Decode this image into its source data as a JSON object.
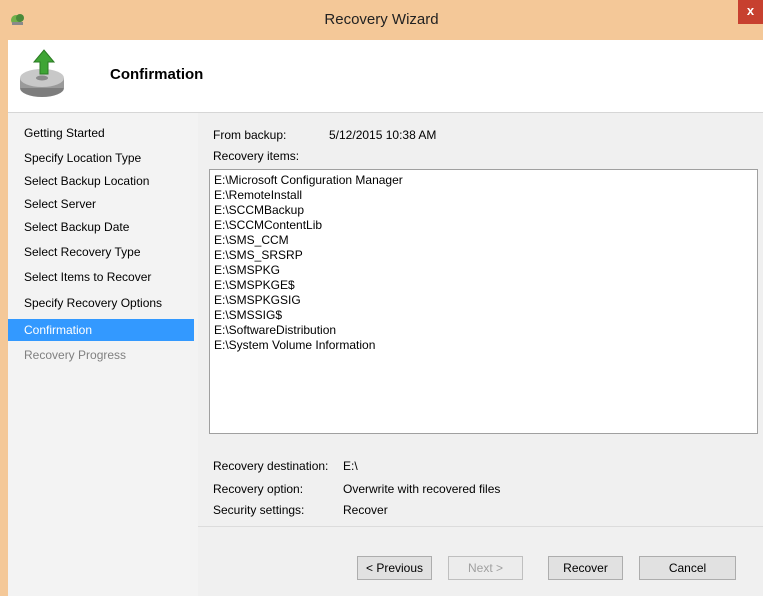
{
  "window": {
    "title": "Recovery Wizard",
    "close_glyph": "x",
    "icon": "backup-app-icon"
  },
  "header": {
    "title": "Confirmation",
    "icon": "restore-disk-icon"
  },
  "nav": {
    "items": [
      {
        "label": "Getting Started",
        "state": "normal"
      },
      {
        "label": "Specify Location Type",
        "state": "normal"
      },
      {
        "label": "Select Backup Location",
        "state": "normal"
      },
      {
        "label": "Select Server",
        "state": "normal"
      },
      {
        "label": "Select Backup Date",
        "state": "normal"
      },
      {
        "label": "Select Recovery Type",
        "state": "normal"
      },
      {
        "label": "Select Items to Recover",
        "state": "normal"
      },
      {
        "label": "Specify Recovery Options",
        "state": "normal"
      },
      {
        "label": "Confirmation",
        "state": "active"
      },
      {
        "label": "Recovery Progress",
        "state": "disabled"
      }
    ]
  },
  "main": {
    "from_backup_label": "From backup:",
    "from_backup_value": "5/12/2015 10:38 AM",
    "recovery_items_label": "Recovery items:",
    "recovery_items": [
      "E:\\Microsoft Configuration Manager",
      "E:\\RemoteInstall",
      "E:\\SCCMBackup",
      "E:\\SCCMContentLib",
      "E:\\SMS_CCM",
      "E:\\SMS_SRSRP",
      "E:\\SMSPKG",
      "E:\\SMSPKGE$",
      "E:\\SMSPKGSIG",
      "E:\\SMSSIG$",
      "E:\\SoftwareDistribution",
      "E:\\System Volume Information"
    ],
    "destination_label": "Recovery destination:",
    "destination_value": "E:\\",
    "option_label": "Recovery option:",
    "option_value": "Overwrite with recovered files",
    "security_label": "Security settings:",
    "security_value": "Recover"
  },
  "buttons": {
    "previous": "< Previous",
    "next": "Next >",
    "recover": "Recover",
    "cancel": "Cancel"
  },
  "colors": {
    "title_bar": "#f4c898",
    "close_button": "#c7402f",
    "selection": "#3399ff"
  }
}
